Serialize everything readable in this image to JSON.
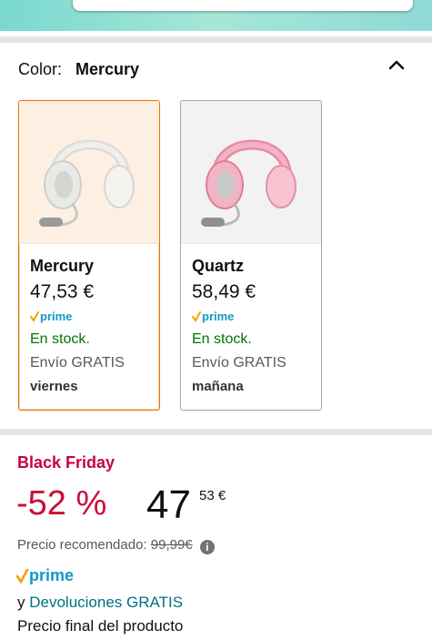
{
  "color_selector": {
    "label": "Color:",
    "selected": "Mercury"
  },
  "variants": [
    {
      "name": "Mercury",
      "price": "47,53 €",
      "prime": "prime",
      "stock": "En stock.",
      "shipping": "Envío GRATIS",
      "delivery": "viernes",
      "selected": true
    },
    {
      "name": "Quartz",
      "price": "58,49 €",
      "prime": "prime",
      "stock": "En stock.",
      "shipping": "Envío GRATIS",
      "delivery": "mañana",
      "selected": false
    }
  ],
  "deal": {
    "badge": "Black Friday",
    "discount": "-52 %",
    "price_whole": "47",
    "price_fraction": "53 €",
    "rrp_label": "Precio recomendado:",
    "rrp_value": "99,99€",
    "prime": "prime",
    "returns_prefix": "y",
    "returns_link": "Devoluciones GRATIS",
    "final_price_note": "Precio final del producto"
  },
  "colors": {
    "accent_orange": "#e77600",
    "stock_green": "#007600",
    "deal_red": "#cc0c39",
    "link_teal": "#007185",
    "prime_blue": "#1399c6"
  }
}
